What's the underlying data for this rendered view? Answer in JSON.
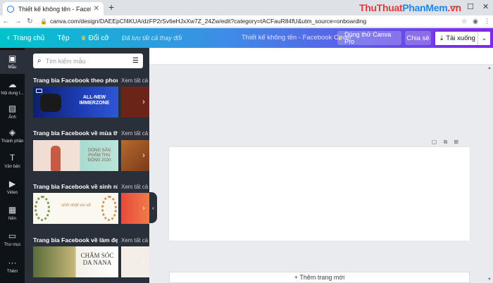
{
  "browser": {
    "tab_title": "Thiết kế không tên - Facebook C",
    "url": "canva.com/design/DAEEpCf4KUA/dzFP2rSv6eHJxXw7Z_24Zw/edit?category=tACFauR84fU&utm_source=onboarding",
    "watermark_part1": "ThuThuat",
    "watermark_part2": "PhanMem",
    "watermark_part3": ".vn"
  },
  "topbar": {
    "home_label": "Trang chủ",
    "file_label": "Tệp",
    "resize_label": "Đổi cỡ",
    "saved_status": "Đã lưu tất cả thay đổi",
    "design_title": "Thiết kế không tên - Facebook Cover",
    "pro_label": "Dùng thử Canva Pro",
    "share_label": "Chia sẻ",
    "download_label": "Tải xuống"
  },
  "rail": {
    "items": [
      {
        "label": "Mẫu",
        "icon": "template-icon"
      },
      {
        "label": "Nội dung t...",
        "icon": "upload-icon"
      },
      {
        "label": "Ảnh",
        "icon": "photo-icon"
      },
      {
        "label": "Thành phần",
        "icon": "elements-icon"
      },
      {
        "label": "Văn bản",
        "icon": "text-icon"
      },
      {
        "label": "Video",
        "icon": "video-icon"
      },
      {
        "label": "Nền",
        "icon": "background-icon"
      },
      {
        "label": "Thư mục",
        "icon": "folder-icon"
      },
      {
        "label": "Thêm",
        "icon": "more-icon"
      }
    ]
  },
  "panel": {
    "search_placeholder": "Tìm kiếm mẫu",
    "sections": [
      {
        "title": "Trang bìa Facebook theo phong c...",
        "see_all": "Xem tất cả",
        "thumb_text": "ALL-NEW IMMERZONE"
      },
      {
        "title": "Trang bìa Facebook về mùa thu",
        "see_all": "Xem tất cả",
        "thumb_text": "DÒNG SẢN PHẨM THU ĐÔNG 2020"
      },
      {
        "title": "Trang bìa Facebook về sinh nhật",
        "see_all": "Xem tất cả",
        "thumb_text": "sinh nhật vui vẻ"
      },
      {
        "title": "Trang bìa Facebook về làm đẹp",
        "see_all": "Xem tất cả",
        "thumb_text": "CHĂM SÓC DA NANA"
      }
    ]
  },
  "workspace": {
    "add_page_label": "+ Thêm trang mới"
  }
}
